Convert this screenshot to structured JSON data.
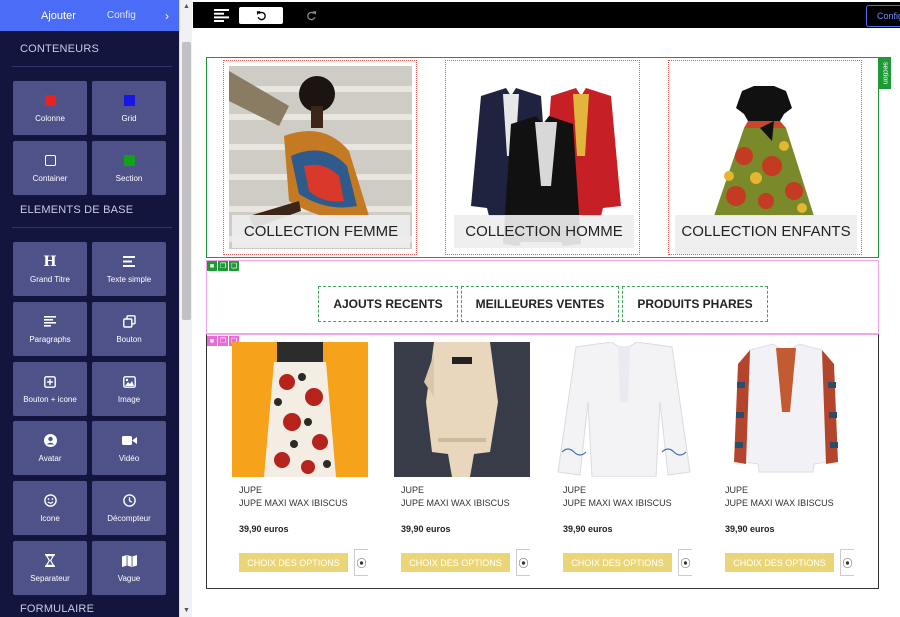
{
  "sidebar": {
    "tabs": {
      "add": "Ajouter",
      "config": "Config"
    },
    "sections": {
      "containers": "CONTENEURS",
      "basics": "ELEMENTS DE BASE",
      "form": "FORMULAIRE"
    },
    "tiles": [
      {
        "label": "Colonne",
        "icon": "red-square-icon"
      },
      {
        "label": "Grid",
        "icon": "blue-square-icon"
      },
      {
        "label": "Container",
        "icon": "square-outline-icon"
      },
      {
        "label": "Section",
        "icon": "green-square-icon"
      },
      {
        "label": "Grand Titre",
        "icon": "heading-icon"
      },
      {
        "label": "Texte simple",
        "icon": "text-lines-icon"
      },
      {
        "label": "Paragraphs",
        "icon": "paragraph-icon"
      },
      {
        "label": "Bouton",
        "icon": "copy-icon"
      },
      {
        "label": "Bouton + icone",
        "icon": "plus-box-icon"
      },
      {
        "label": "Image",
        "icon": "image-icon"
      },
      {
        "label": "Avatar",
        "icon": "user-circle-icon"
      },
      {
        "label": "Vidéo",
        "icon": "video-camera-icon"
      },
      {
        "label": "Icone",
        "icon": "smiley-icon"
      },
      {
        "label": "Décompteur",
        "icon": "clock-icon"
      },
      {
        "label": "Separateur",
        "icon": "hourglass-icon"
      },
      {
        "label": "Vague",
        "icon": "map-icon"
      }
    ]
  },
  "topbar": {
    "config": "Config"
  },
  "canvas": {
    "section_tag": "section",
    "collections": [
      {
        "title": "COLLECTION FEMME"
      },
      {
        "title": "COLLECTION HOMME"
      },
      {
        "title": "COLLECTION ENFANTS"
      }
    ],
    "tabs": [
      "AJOUTS RECENTS",
      "MEILLEURES VENTES",
      "PRODUITS PHARES"
    ],
    "products": [
      {
        "category": "JUPE",
        "name": "JUPE MAXI WAX IBISCUS",
        "price": "39,90 euros",
        "button": "CHOIX DES OPTIONS"
      },
      {
        "category": "JUPE",
        "name": "JUPE MAXI WAX IBISCUS",
        "price": "39,90 euros",
        "button": "CHOIX DES OPTIONS"
      },
      {
        "category": "JUPE",
        "name": "JUPE MAXI WAX IBISCUS",
        "price": "39,90 euros",
        "button": "CHOIX DES OPTIONS"
      },
      {
        "category": "JUPE",
        "name": "JUPE MAXI WAX IBISCUS",
        "price": "39,90 euros",
        "button": "CHOIX DES OPTIONS"
      }
    ]
  },
  "colors": {
    "sidebar_bg": "#13153f",
    "tile_bg": "#4f5189",
    "accent_blue": "#4a6cf7",
    "section_green": "#1d9a36",
    "options_button": "#ead678"
  }
}
